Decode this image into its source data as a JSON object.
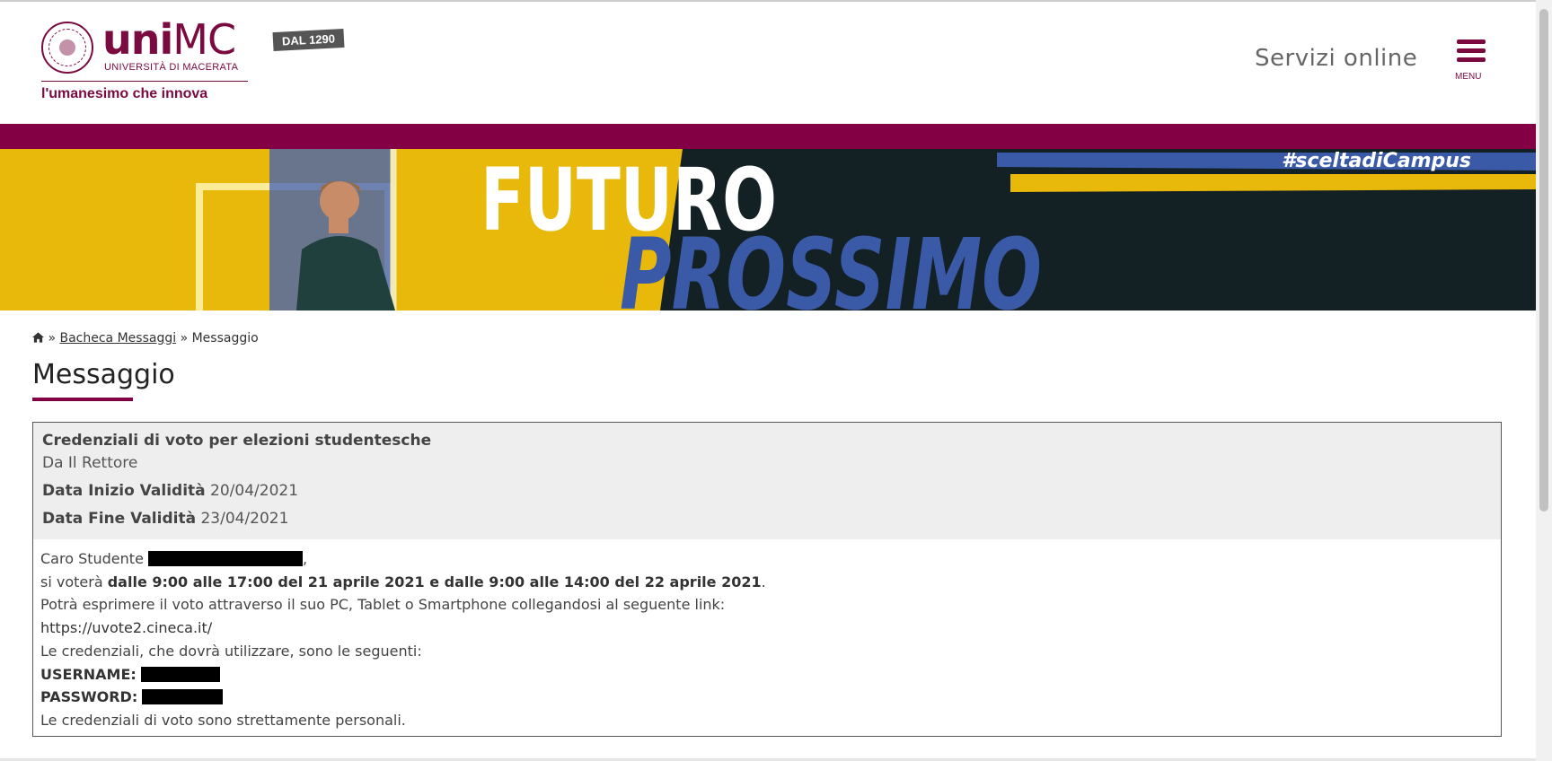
{
  "header": {
    "logo_word_bold": "uni",
    "logo_word_thin": "MC",
    "logo_sub": "UNIVERSITÀ DI MACERATA",
    "logo_tagline": "l'umanesimo che innova",
    "badge": "DAL 1290",
    "services_link": "Servizi online",
    "menu_label": "MENU"
  },
  "hero": {
    "word1": "FUTURO",
    "word2": "PROSSIMO",
    "hashtag": "#sceltadiCampus"
  },
  "breadcrumb": {
    "separator": "»",
    "link": "Bacheca Messaggi",
    "current": "Messaggio"
  },
  "page_title": "Messaggio",
  "message": {
    "subject": "Credenziali di voto per elezioni studentesche",
    "from": "Da Il Rettore",
    "start_label": "Data Inizio Validità",
    "start_value": "20/04/2021",
    "end_label": "Data Fine Validità",
    "end_value": "23/04/2021",
    "body": {
      "greeting": "Caro Studente",
      "greeting_end": ",",
      "vote_prefix": "si voterà",
      "vote_schedule": "dalle 9:00 alle 17:00 del 21 aprile 2021 e dalle 9:00 alle 14:00 del 22 aprile 2021",
      "vote_end": ".",
      "device_line": "Potrà esprimere il voto attraverso il suo PC, Tablet o Smartphone collegandosi al seguente link:",
      "link": "https://uvote2.cineca.it/",
      "credentials_intro": "Le credenziali, che dovrà utilizzare, sono le seguenti:",
      "username_label": "USERNAME:",
      "password_label": "PASSWORD:",
      "closing": "Le credenziali di voto sono strettamente personali."
    }
  },
  "colors": {
    "brand": "#830044",
    "hero_yellow": "#e8b80a",
    "hero_dark": "#132024",
    "hero_blue": "#3a5aa8"
  }
}
